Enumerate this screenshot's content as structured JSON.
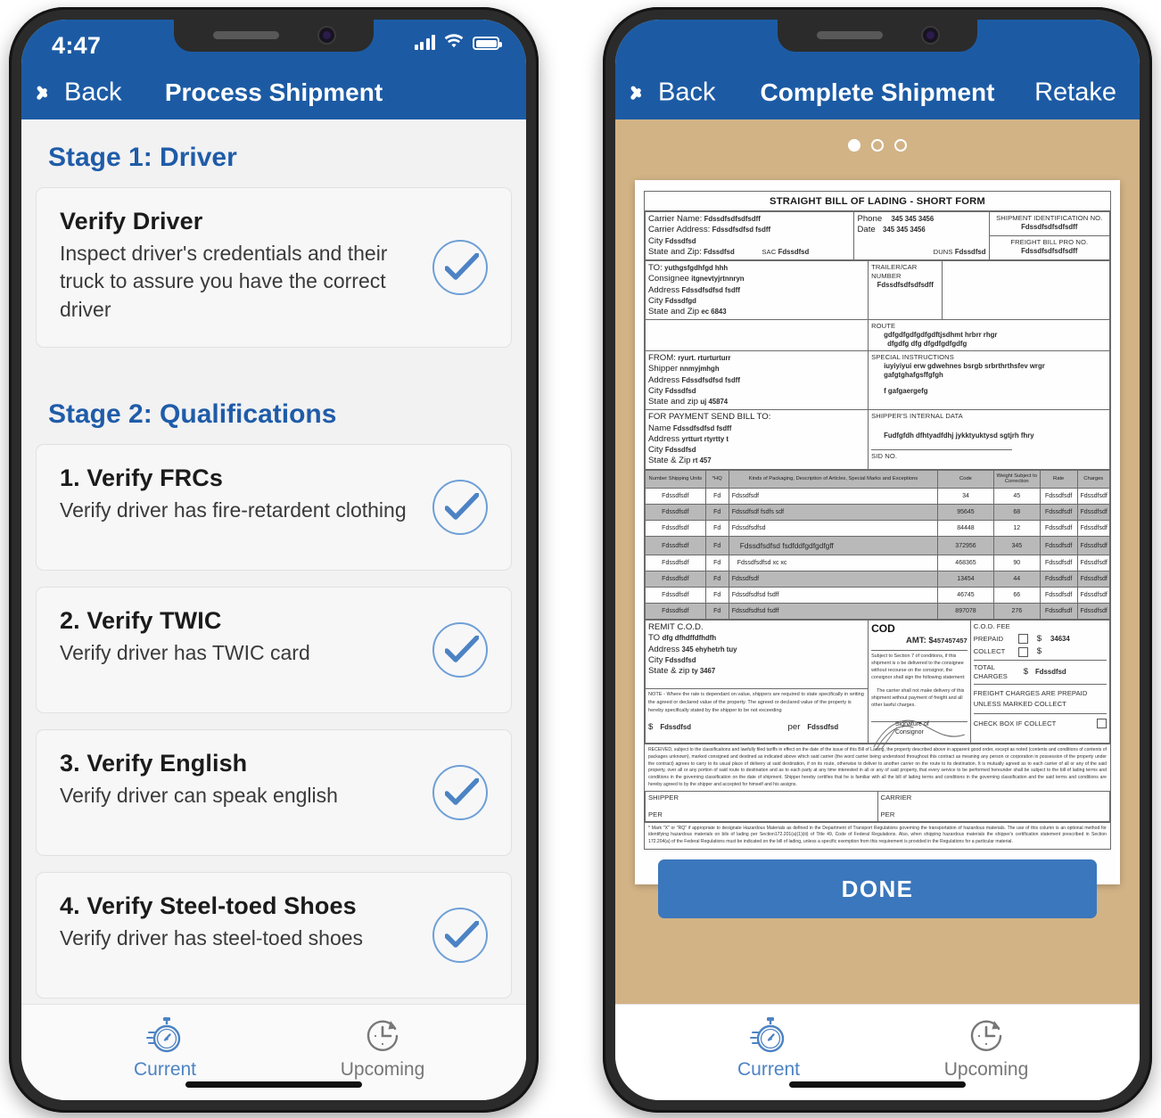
{
  "left_phone": {
    "status": {
      "time": "4:47",
      "signal_icon": "cellular-bars-icon",
      "wifi_icon": "wifi-icon",
      "battery_icon": "battery-full-icon"
    },
    "nav": {
      "back_label": "Back",
      "title": "Process Shipment"
    },
    "stages": [
      {
        "heading": "Stage 1: Driver",
        "cards": [
          {
            "title": "Verify Driver",
            "subtitle": "Inspect driver's credentials and their truck to assure you have the correct driver",
            "status_icon": "check-circle-icon"
          }
        ]
      },
      {
        "heading": "Stage 2: Qualifications",
        "cards": [
          {
            "title": "1. Verify FRCs",
            "subtitle": "Verify driver has fire-retardent clothing",
            "status_icon": "check-circle-icon"
          },
          {
            "title": "2. Verify TWIC",
            "subtitle": "Verify driver has TWIC card",
            "status_icon": "check-circle-icon"
          },
          {
            "title": "3. Verify English",
            "subtitle": "Verify driver can speak english",
            "status_icon": "check-circle-icon"
          },
          {
            "title": "4. Verify Steel-toed Shoes",
            "subtitle": "Verify driver has steel-toed shoes",
            "status_icon": "check-circle-icon"
          }
        ]
      }
    ],
    "tabbar": [
      {
        "label": "Current",
        "icon": "stopwatch-icon",
        "active": true
      },
      {
        "label": "Upcoming",
        "icon": "clock-arrow-icon",
        "active": false
      }
    ]
  },
  "right_phone": {
    "nav": {
      "back_label": "Back",
      "title": "Complete Shipment",
      "action_label": "Retake"
    },
    "page_dots": {
      "count": 3,
      "active_index": 0
    },
    "done_button": "DONE",
    "tabbar": [
      {
        "label": "Current",
        "icon": "stopwatch-icon",
        "active": true
      },
      {
        "label": "Upcoming",
        "icon": "clock-arrow-icon",
        "active": false
      }
    ],
    "document": {
      "title": "STRAIGHT BILL OF LADING - SHORT FORM",
      "carrier": {
        "name_label": "Carrier Name:",
        "name_value": "Fdssdfsdfsdfsdff",
        "address_label": "Carrier Address:",
        "address_value": "Fdssdfsdfsd fsdff",
        "city_label": "City",
        "city_value": "Fdssdfsd",
        "state_label": "State and Zip:",
        "state_value": "Fdssdfsd",
        "sac_label": "SAC",
        "sac_value": "Fdssdfsd",
        "duns_label": "DUNS",
        "duns_value": "Fdssdfsd",
        "phone_label": "Phone",
        "phone_value": "345 345 3456",
        "date_label": "Date",
        "date_value": "345 345 3456"
      },
      "shipment_id": {
        "label": "SHIPMENT IDENTIFICATION NO.",
        "value": "Fdssdfsdfsdfsdff"
      },
      "freight_pro": {
        "label": "FREIGHT BILL PRO NO.",
        "value": "Fdssdfsdfsdfsdff"
      },
      "trailer": {
        "label": "TRAILER/CAR NUMBER",
        "value": "Fdssdfsdfsdfsdff"
      },
      "to": {
        "to_label": "TO:",
        "to_value": "yuthgsfgdhfgd hhh",
        "consignee_label": "Consignee",
        "consignee_value": "itgnevtyjrtnnryn",
        "address_label": "Address",
        "address_value": "Fdssdfsdfsd fsdff",
        "city_label": "City",
        "city_value": "Fdssdfgd",
        "state_label": "State and Zip",
        "state_value": "ec 6843"
      },
      "route": {
        "label": "ROUTE",
        "line1": "gdfgdfgdfgdfgdftjsdhmt hrbrr rhgr",
        "line2": "dfgdfg dfg dfgdfgdfgdfg"
      },
      "from": {
        "from_label": "FROM:",
        "from_value": "ryurt. rturturturr",
        "shipper_label": "Shipper",
        "shipper_value": "nnmyjmhgh",
        "address_label": "Address",
        "address_value": "Fdssdfsdfsd fsdff",
        "city_label": "City",
        "city_value": "Fdssdfsd",
        "state_label": "State and zip",
        "state_value": "uj 45874"
      },
      "special": {
        "label": "SPECIAL INSTRUCTIONS",
        "line1": "iuyiyiyui erw gdwehnes bsrgb srbrthrthsfev wrgr",
        "line2": "gafgtghafgsffgfgh",
        "line3": "f gafgaergefg"
      },
      "payment": {
        "header": "FOR PAYMENT SEND BILL TO:",
        "name_label": "Name",
        "name_value": "Fdssdfsdfsd fsdff",
        "address_label": "Address",
        "address_value": "yrtturt rtyrtty t",
        "city_label": "City",
        "city_value": "Fdssdfsd",
        "state_label": "State & Zip",
        "state_value": "rt 457"
      },
      "internal": {
        "label": "SHIPPER'S INTERNAL DATA",
        "value": "Fudfgfdh dfhtyadfdhj jykktyuktysd sgtjrh fhry"
      },
      "sid": {
        "label": "SID NO."
      },
      "articles_table": {
        "columns": [
          "Number Shipping Units",
          "*HQ",
          "Kinds of Packaging, Description of Articles, Special Marks and Exceptions",
          "Code",
          "Weight Subject to Correction",
          "Rate",
          "Charges"
        ],
        "rows": [
          [
            "Fdssdfsdf",
            "Fd",
            "Fdssdfsdf",
            "34",
            "45",
            "Fdssdfsdf",
            "Fdssdfsdf"
          ],
          [
            "Fdssdfsdf",
            "Fd",
            "Fdssdfsdf fsdfs sdf",
            "95645",
            "68",
            "Fdssdfsdf",
            "Fdssdfsdf"
          ],
          [
            "Fdssdfsdf",
            "Fd",
            "Fdssdfsdfsd",
            "84448",
            "12",
            "Fdssdfsdf",
            "Fdssdfsdf"
          ],
          [
            "Fdssdfsdf",
            "Fd",
            "Fdssdfsdfsd fsdfddfgdfgdfgff",
            "372956",
            "345",
            "Fdssdfsdf",
            "Fdssdfsdf"
          ],
          [
            "Fdssdfsdf",
            "Fd",
            "Fdssdfsdfsd xc xc",
            "468365",
            "90",
            "Fdssdfsdf",
            "Fdssdfsdf"
          ],
          [
            "Fdssdfsdf",
            "Fd",
            "Fdssdfsdf",
            "13454",
            "44",
            "Fdssdfsdf",
            "Fdssdfsdf"
          ],
          [
            "Fdssdfsdf",
            "Fd",
            "Fdssdfsdfsd fsdff",
            "46745",
            "66",
            "Fdssdfsdf",
            "Fdssdfsdf"
          ],
          [
            "Fdssdfsdf",
            "Fd",
            "Fdssdfsdfsd fsdff",
            "897078",
            "276",
            "Fdssdfsdf",
            "Fdssdfsdf"
          ]
        ]
      },
      "remit": {
        "header": "REMIT C.O.D.",
        "to_label": "TO",
        "to_value": "dfg dfhdffdfhdfh",
        "address_label": "Address",
        "address_value": "345 ehyhetrh tuy",
        "city_label": "City",
        "city_value": "Fdssdfsd",
        "state_label": "State & zip",
        "state_value": "ty 3467"
      },
      "note": {
        "text": "NOTE - Where the rate is dependant on value, shippers are required to state specifically in writing the agreed or declared value of the property. The agreed or declared value of the property is hereby specifically stated by the shipper to be not exceeding",
        "dollar": "$",
        "dollar_value": "Fdssdfsd",
        "per_label": "per",
        "per_value": "Fdssdfsd"
      },
      "cod": {
        "title": "COD",
        "amt_label": "AMT: $",
        "amt_value": "457457457",
        "para1": "Subject to Section 7 of conditions, if this shipment is o be delivered to the consignee without recourse on the consignor, the consignor shall sign the following statement:",
        "para2": "The carrier shall not make delivery of this shipment without payment of freight and all other lawful charges.",
        "signature_label": "Signature of Consignor"
      },
      "cod_fee": {
        "label": "C.O.D. FEE",
        "prepaid_label": "PREPAID",
        "prepaid_dollar": "$",
        "prepaid_value": "34634",
        "collect_label": "COLLECT",
        "collect_dollar": "$",
        "total_label": "TOTAL",
        "charges_label": "CHARGES",
        "total_dollar": "$",
        "total_value": "Fdssdfsd",
        "freight_note": "FREIGHT CHARGES ARE PREPAID UNLESS MARKED COLLECT",
        "checkbox_label": "CHECK BOX IF COLLECT"
      },
      "received_legal": "RECEIVED, subject to the classifications and lawfully filed tariffs in effect on the date of the issue of this Bill of Lading, the property described above in apparent good order, except as noted (contents and conditions of contents of packages unknown), marked consigned and destined as indicated above which said carrier (the word carrier being understood throughout this contract as meaning any person or corporation in possession of the property under the contract) agrees to carry to its usual place of delivery at said destination, if on its route, otherwise to deliver to another carrier on the route to its destination. It is mutually agreed as to each carrier of all or any of the said property, over all or any portion of said route to destination and as to each party at any time interested in all or any of said property, that every service to be performed hereunder shall be subject to the bill of lading terms and conditions in the governing classification on the date of shipment. Shipper hereby certifies that he is familiar with all the bill of lading terms and conditions in the governing classification and the said terms and conditions are hereby agreed to by the shipper and accepted for himself and his assigns.",
      "shipper_sign": {
        "label": "SHIPPER",
        "per": "PER"
      },
      "carrier_sign": {
        "label": "CARRIER",
        "per": "PER"
      },
      "footnote": "* Mark \"X\" or \"RQ\" if appropriate to designate Hazardous Materials as defined in the Department of Transport Regulations governing the transportation of hazardous materials.  The use of this column is an optional method for identifying hazardous materials on bils of lading per Section172.201(a)(1)(iii) of Title 49, Code of Federal Regulations.  Also, when shipping hazardous materials the shipper's certification statement prescribed in Section 172.204(a) of the Federal Regulations must be indicated on the bill of lading, unless a specific exemption from this requirement is provided in the Regulations for a particular material."
    }
  },
  "colors": {
    "nav_blue": "#1c5ba4",
    "accent_blue": "#4c83c4",
    "button_blue": "#3b77bd",
    "heading_blue": "#1f5ca8"
  }
}
